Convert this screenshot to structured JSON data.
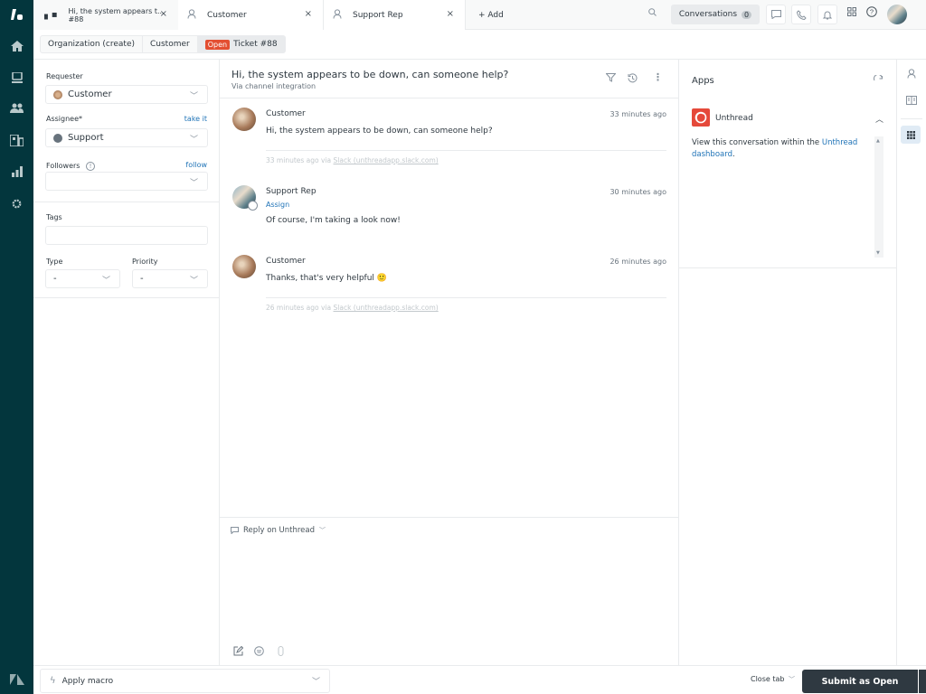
{
  "tabs": [
    {
      "title": "Hi, the system appears t...",
      "subtitle": "#88",
      "active": true
    },
    {
      "title": "Customer",
      "active": false
    },
    {
      "title": "Support Rep",
      "active": false
    }
  ],
  "add_tab_label": "+ Add",
  "header": {
    "conversations_label": "Conversations",
    "conversations_count": "0"
  },
  "breadcrumb": {
    "organization": "Organization (create)",
    "customer": "Customer",
    "status_badge": "Open",
    "ticket": "Ticket #88"
  },
  "ticket_fields": {
    "requester_label": "Requester",
    "requester_value": "Customer",
    "assignee_label": "Assignee*",
    "assignee_link": "take it",
    "assignee_value": "Support",
    "followers_label": "Followers",
    "followers_link": "follow",
    "tags_label": "Tags",
    "type_label": "Type",
    "type_value": "-",
    "priority_label": "Priority",
    "priority_value": "-"
  },
  "conversation": {
    "title": "Hi, the system appears to be down, can someone help?",
    "subtitle": "Via channel integration",
    "messages": [
      {
        "author": "Customer",
        "time": "33 minutes ago",
        "body": "Hi, the system appears to be down, can someone help?",
        "via_prefix": "33 minutes ago via ",
        "via_link": "Slack (unthreadapp.slack.com)"
      },
      {
        "author": "Support Rep",
        "time": "30 minutes ago",
        "assign": "Assign",
        "body": "Of course, I'm taking a look now!"
      },
      {
        "author": "Customer",
        "time": "26 minutes ago",
        "body": "Thanks, that's very helpful 🙂",
        "via_prefix": "26 minutes ago via ",
        "via_link": "Slack (unthreadapp.slack.com)"
      }
    ]
  },
  "reply": {
    "channel_label": "Reply on Unthread"
  },
  "apps": {
    "title": "Apps",
    "app_name": "Unthread",
    "description_prefix": "View this conversation within the ",
    "description_link": "Unthread dashboard",
    "description_suffix": "."
  },
  "footer": {
    "macro_label": "Apply macro",
    "close_tab_label": "Close tab",
    "submit_label": "Submit as Open"
  },
  "colors": {
    "rail": "#03363d",
    "open_badge": "#e34f32",
    "link": "#1f73b7",
    "submit": "#2f3941",
    "unthread_brand": "#e5493a"
  }
}
